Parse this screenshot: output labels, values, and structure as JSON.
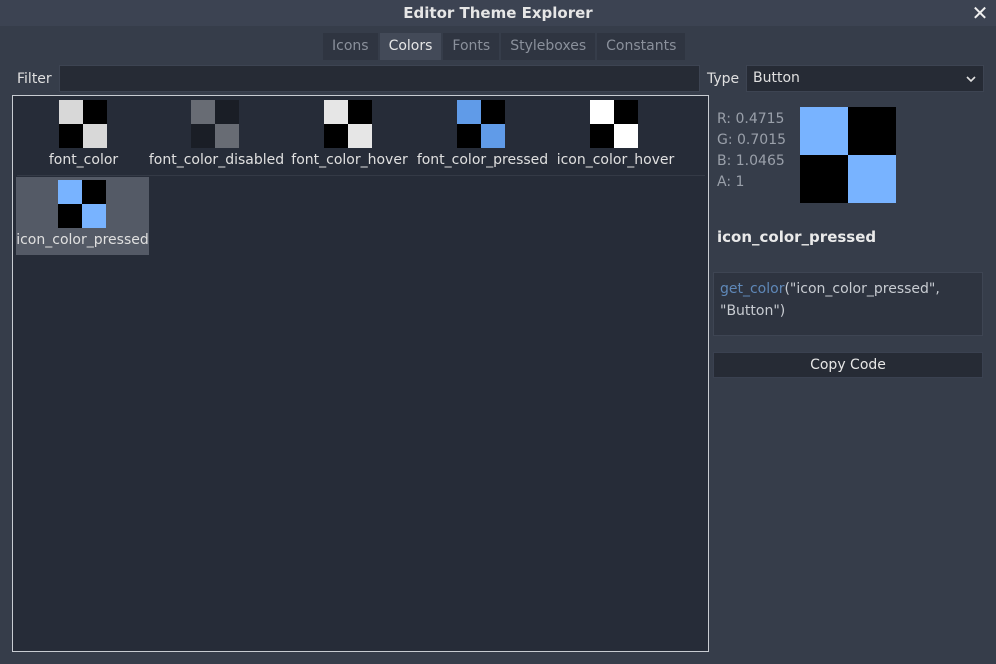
{
  "window": {
    "title": "Editor Theme Explorer",
    "close_glyph": "✕"
  },
  "tabs": [
    {
      "label": "Icons",
      "active": false
    },
    {
      "label": "Colors",
      "active": true
    },
    {
      "label": "Fonts",
      "active": false
    },
    {
      "label": "Styleboxes",
      "active": false
    },
    {
      "label": "Constants",
      "active": false
    }
  ],
  "filter": {
    "label": "Filter",
    "value": ""
  },
  "type": {
    "label": "Type",
    "value": "Button"
  },
  "colors": [
    {
      "name": "font_color",
      "swatch": [
        "#d8d8d8",
        "#000000",
        "#000000",
        "#d8d8d8"
      ],
      "selected": false
    },
    {
      "name": "font_color_disabled",
      "swatch": [
        "#686c74",
        "#1a1e26",
        "#1a1e26",
        "#686c74"
      ],
      "selected": false
    },
    {
      "name": "font_color_hover",
      "swatch": [
        "#e6e6e6",
        "#000000",
        "#000000",
        "#e6e6e6"
      ],
      "selected": false
    },
    {
      "name": "font_color_pressed",
      "swatch": [
        "#609be8",
        "#000000",
        "#000000",
        "#609be8"
      ],
      "selected": false
    },
    {
      "name": "icon_color_hover",
      "swatch": [
        "#ffffff",
        "#000000",
        "#000000",
        "#ffffff"
      ],
      "selected": false
    },
    {
      "name": "icon_color_pressed",
      "swatch": [
        "#78b3ff",
        "#000000",
        "#000000",
        "#78b3ff"
      ],
      "selected": true
    }
  ],
  "detail": {
    "r": "R: 0.4715",
    "g": "G: 0.7015",
    "b": "B: 1.0465",
    "a": "A: 1",
    "swatch": [
      "#78b3ff",
      "#000000",
      "#000000",
      "#78b3ff"
    ],
    "name": "icon_color_pressed",
    "code_fn": "get_color",
    "code_args_line1": "(\"icon_color_pressed\",",
    "code_args_line2": "\"Button\")",
    "copy_label": "Copy Code"
  },
  "icons": {
    "close": "close-icon",
    "dropdown": "chevron-down-icon"
  }
}
